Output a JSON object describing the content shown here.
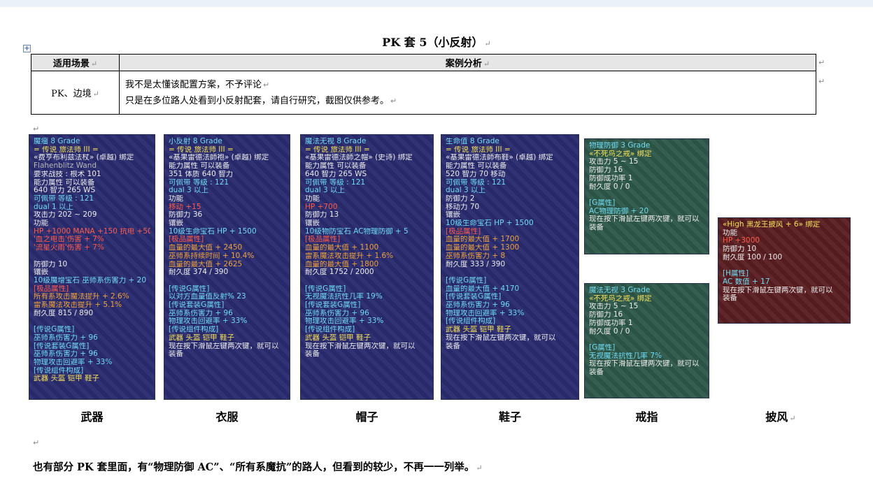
{
  "title": "PK 套 5（小反射）",
  "table": {
    "headers": [
      "适用场景",
      "案例分析"
    ],
    "scene": "PK、边境",
    "analysis": [
      "我不是太懂该配置方案，不予评论",
      "只是在多位路人处看到小反射配套，请自行研究，截图仅供参考。"
    ]
  },
  "items": [
    {
      "caption": "武器",
      "theme": "blue",
      "lines": [
        {
          "t": "魔瘤            8 Grade",
          "c": "c-cyan"
        },
        {
          "t": "= 传说 旅法师 III =",
          "c": "c-yellow"
        },
        {
          "t": "«费亨布利兹法杖» (卓越) 绑定",
          "c": "c-white"
        },
        {
          "t": "Flahenblitz Wand",
          "c": "c-gray"
        },
        {
          "t": "要求战技 : 根术 101",
          "c": "c-white"
        },
        {
          "t": "能力属性       可以装备",
          "c": "c-white"
        },
        {
          "t": "  640 智力  265 WS",
          "c": "c-white"
        },
        {
          "t": "  可佩带 等级 : 121",
          "c": "c-cyan"
        },
        {
          "t": "  dual 1 以上",
          "c": "c-cyan"
        },
        {
          "t": "攻击力 202 ~ 209",
          "c": "c-white"
        },
        {
          "t": "功能",
          "c": "c-white"
        },
        {
          "t": "HP +1000 MANA +150 抗电 +50",
          "c": "c-red"
        },
        {
          "t": "'血之电击'伤害 + 7%",
          "c": "c-red"
        },
        {
          "t": "'流星火雨'伤害 + 7%",
          "c": "c-red"
        },
        {
          "t": "",
          "c": "c-white"
        },
        {
          "t": "防御力 10",
          "c": "c-white"
        },
        {
          "t": "镶嵌",
          "c": "c-white"
        },
        {
          "t": "10级魔增宝石 巫师系伤害力 + 20",
          "c": "c-cyan"
        },
        {
          "t": "[极品属性]",
          "c": "c-red"
        },
        {
          "t": "所有系攻击魔法提升 + 2.6%",
          "c": "c-orange"
        },
        {
          "t": "雷系魔法攻击提升 + 5.1%",
          "c": "c-orange"
        },
        {
          "t": "        耐久度 815 / 890",
          "c": "c-white"
        },
        {
          "t": "",
          "c": "c-white"
        },
        {
          "t": "[传说G属性]",
          "c": "c-cyan"
        },
        {
          "t": "巫师系伤害力 + 96",
          "c": "c-cyan"
        },
        {
          "t": "[传说套装G属性]",
          "c": "c-cyan"
        },
        {
          "t": "巫师系伤害力 + 96",
          "c": "c-cyan"
        },
        {
          "t": "物理攻击回避率 + 33%",
          "c": "c-cyan"
        },
        {
          "t": "[传说组件构成]",
          "c": "c-cyan"
        },
        {
          "t": "武器 头盔 铠甲 鞋子",
          "c": "c-yellow"
        }
      ]
    },
    {
      "caption": "衣服",
      "theme": "blue",
      "lines": [
        {
          "t": "小反射            8 Grade",
          "c": "c-cyan"
        },
        {
          "t": "= 传说 旅法师 III =",
          "c": "c-yellow"
        },
        {
          "t": "«基果雷德法師袍» (卓越) 绑定",
          "c": "c-white"
        },
        {
          "t": "能力属性       可以装备",
          "c": "c-white"
        },
        {
          "t": "  351 体质  640 智力",
          "c": "c-white"
        },
        {
          "t": "  可佩带 等级 : 121",
          "c": "c-cyan"
        },
        {
          "t": "  dual 3 以上",
          "c": "c-cyan"
        },
        {
          "t": "功能",
          "c": "c-white"
        },
        {
          "t": "移动 +15",
          "c": "c-red"
        },
        {
          "t": "防御力 36",
          "c": "c-white"
        },
        {
          "t": "镶嵌",
          "c": "c-white"
        },
        {
          "t": "10级生命宝石 HP + 1500",
          "c": "c-cyan"
        },
        {
          "t": "[极品属性]",
          "c": "c-red"
        },
        {
          "t": "血量的最大值 + 2450",
          "c": "c-orange"
        },
        {
          "t": "巫师系持续时间 + 10.4%",
          "c": "c-orange"
        },
        {
          "t": "血量的最大值 + 2625",
          "c": "c-orange"
        },
        {
          "t": "        耐久度 374 / 390",
          "c": "c-white"
        },
        {
          "t": "",
          "c": "c-white"
        },
        {
          "t": "[传说G属性]",
          "c": "c-cyan"
        },
        {
          "t": "以对方血量值反射%  23",
          "c": "c-cyan"
        },
        {
          "t": "[传说套装G属性]",
          "c": "c-cyan"
        },
        {
          "t": "巫师系伤害力 + 96",
          "c": "c-cyan"
        },
        {
          "t": "物理攻击回避率 + 33%",
          "c": "c-cyan"
        },
        {
          "t": "[传说组件构成]",
          "c": "c-cyan"
        },
        {
          "t": "武器 头盔 铠甲 鞋子",
          "c": "c-yellow"
        },
        {
          "t": "现在按下滑鼠左键两次键，就可以",
          "c": "c-white"
        },
        {
          "t": "装备",
          "c": "c-white"
        }
      ]
    },
    {
      "caption": "帽子",
      "theme": "blue",
      "lines": [
        {
          "t": "魔法无视            8 Grade",
          "c": "c-cyan"
        },
        {
          "t": "= 传说 旅法师 III =",
          "c": "c-yellow"
        },
        {
          "t": "«基果雷德法師之帽» (史诗) 绑定",
          "c": "c-white"
        },
        {
          "t": "能力属性       可以装备",
          "c": "c-white"
        },
        {
          "t": "  640 智力  265 WS",
          "c": "c-white"
        },
        {
          "t": "  可佩带 等级 : 121",
          "c": "c-cyan"
        },
        {
          "t": "  dual 3 以上",
          "c": "c-cyan"
        },
        {
          "t": "功能",
          "c": "c-white"
        },
        {
          "t": "HP +700",
          "c": "c-red"
        },
        {
          "t": "防御力 13",
          "c": "c-white"
        },
        {
          "t": "镶嵌",
          "c": "c-white"
        },
        {
          "t": "10级物防宝石 AC物理防御 + 5",
          "c": "c-cyan"
        },
        {
          "t": "[极品属性]",
          "c": "c-red"
        },
        {
          "t": "血量的最大值 + 1100",
          "c": "c-orange"
        },
        {
          "t": "雷系魔法攻击提升 + 1.6%",
          "c": "c-orange"
        },
        {
          "t": "血量的最大值 + 1800",
          "c": "c-orange"
        },
        {
          "t": "        耐久度 1752 / 2000",
          "c": "c-white"
        },
        {
          "t": "",
          "c": "c-white"
        },
        {
          "t": "[传说G属性]",
          "c": "c-cyan"
        },
        {
          "t": "无视魔法抗性几率    19%",
          "c": "c-cyan"
        },
        {
          "t": "[传说套装G属性]",
          "c": "c-cyan"
        },
        {
          "t": "巫师系伤害力 + 96",
          "c": "c-cyan"
        },
        {
          "t": "物理攻击回避率 + 33%",
          "c": "c-cyan"
        },
        {
          "t": "[传说组件构成]",
          "c": "c-cyan"
        },
        {
          "t": "武器 头盔 铠甲 鞋子",
          "c": "c-yellow"
        },
        {
          "t": "现在按下滑鼠左键两次键，就可以",
          "c": "c-white"
        },
        {
          "t": "装备",
          "c": "c-white"
        }
      ]
    },
    {
      "caption": "鞋子",
      "theme": "blue",
      "lines": [
        {
          "t": "生命值            8 Grade",
          "c": "c-cyan"
        },
        {
          "t": "= 传说 旅法师 III =",
          "c": "c-yellow"
        },
        {
          "t": "«基果雷德法師布鞋» (卓越) 绑定",
          "c": "c-white"
        },
        {
          "t": "能力属性       可以装备",
          "c": "c-white"
        },
        {
          "t": "  520 智力   70 移动",
          "c": "c-white"
        },
        {
          "t": "  可佩带 等级 : 121",
          "c": "c-cyan"
        },
        {
          "t": "  dual 3 以上",
          "c": "c-cyan"
        },
        {
          "t": "防御力 2",
          "c": "c-white"
        },
        {
          "t": "移动力 70",
          "c": "c-white"
        },
        {
          "t": "镶嵌",
          "c": "c-white"
        },
        {
          "t": "10级生命宝石 HP + 1500",
          "c": "c-cyan"
        },
        {
          "t": "[极品属性]",
          "c": "c-red"
        },
        {
          "t": "血量的最大值 + 1700",
          "c": "c-orange"
        },
        {
          "t": "血量的最大值 + 1300",
          "c": "c-orange"
        },
        {
          "t": "巫师系伤害力 + 8",
          "c": "c-orange"
        },
        {
          "t": "        耐久度 333 / 390",
          "c": "c-white"
        },
        {
          "t": "",
          "c": "c-white"
        },
        {
          "t": "[传说G属性]",
          "c": "c-cyan"
        },
        {
          "t": "血量的最大值 + 4170",
          "c": "c-cyan"
        },
        {
          "t": "[传说套装G属性]",
          "c": "c-cyan"
        },
        {
          "t": "巫师系伤害力 + 96",
          "c": "c-cyan"
        },
        {
          "t": "物理攻击回避率 + 33%",
          "c": "c-cyan"
        },
        {
          "t": "[传说组件构成]",
          "c": "c-cyan"
        },
        {
          "t": "武器 头盔 铠甲 鞋子",
          "c": "c-yellow"
        },
        {
          "t": "现在按下滑鼠左键两次键，就可以",
          "c": "c-white"
        },
        {
          "t": "装备",
          "c": "c-white"
        }
      ]
    },
    {
      "caption": "戒指",
      "theme": "green",
      "lines": [
        {
          "t": "物理防御       3 Grade",
          "c": "c-cyan"
        },
        {
          "t": "«不死鸟之戒» 绑定",
          "c": "c-yellow"
        },
        {
          "t": "攻击力 5 ~ 15",
          "c": "c-white"
        },
        {
          "t": "防御力 16",
          "c": "c-white"
        },
        {
          "t": "防御成功率 1",
          "c": "c-white"
        },
        {
          "t": "      耐久度 0 / 0",
          "c": "c-white"
        },
        {
          "t": "",
          "c": "c-white"
        },
        {
          "t": "[G属性]",
          "c": "c-cyan"
        },
        {
          "t": "AC物理防御 + 20",
          "c": "c-cyan"
        },
        {
          "t": "现在按下滑鼠左键两次键，就可以",
          "c": "c-white"
        },
        {
          "t": "装备",
          "c": "c-white"
        }
      ]
    },
    {
      "caption": "",
      "theme": "green",
      "lines": [
        {
          "t": "魔法无视       3 Grade",
          "c": "c-cyan"
        },
        {
          "t": "«不死鸟之戒» 绑定",
          "c": "c-yellow"
        },
        {
          "t": "攻击力 5 ~ 15",
          "c": "c-white"
        },
        {
          "t": "防御力 16",
          "c": "c-white"
        },
        {
          "t": "防御成功率 1",
          "c": "c-white"
        },
        {
          "t": "      耐久度 0 / 0",
          "c": "c-white"
        },
        {
          "t": "",
          "c": "c-white"
        },
        {
          "t": "[G属性]",
          "c": "c-cyan"
        },
        {
          "t": "无视魔法抗性几率  7%",
          "c": "c-cyan"
        },
        {
          "t": "现在按下滑鼠左键两次键，就可以",
          "c": "c-white"
        },
        {
          "t": "装备",
          "c": "c-white"
        }
      ]
    },
    {
      "caption": "披风",
      "theme": "red",
      "lines": [
        {
          "t": "«High 黑龙王披风 + 6» 绑定",
          "c": "c-yellow"
        },
        {
          "t": "功能",
          "c": "c-white"
        },
        {
          "t": "HP +3000",
          "c": "c-red"
        },
        {
          "t": "防御力 10",
          "c": "c-white"
        },
        {
          "t": "      耐久度 100 / 100",
          "c": "c-white"
        },
        {
          "t": "",
          "c": "c-white"
        },
        {
          "t": "[H属性]",
          "c": "c-cyan"
        },
        {
          "t": "AC 数值 + 17",
          "c": "c-cyan"
        },
        {
          "t": "现在按下滑鼠左键两次键，就可以",
          "c": "c-white"
        },
        {
          "t": "装备",
          "c": "c-white"
        }
      ]
    }
  ],
  "footnote": "也有部分 PK 套里面，有“物理防御 AC”、“所有系魔抗”的路人，但看到的较少，不再一一列举。"
}
